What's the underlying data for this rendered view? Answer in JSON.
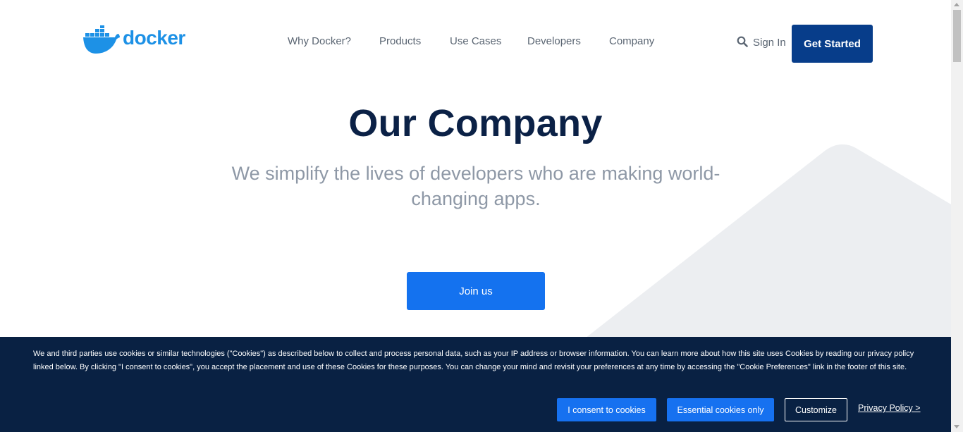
{
  "header": {
    "logo_text": "docker",
    "nav": [
      "Why Docker?",
      "Products",
      "Use Cases",
      "Developers",
      "Company"
    ],
    "sign_in": "Sign In",
    "get_started": "Get Started"
  },
  "hero": {
    "title": "Our Company",
    "subtitle": "We simplify the lives of developers who are making world-changing apps.",
    "join_button": "Join us"
  },
  "cookie_banner": {
    "text": "We and third parties use cookies or similar technologies (\"Cookies\") as described below to collect and process personal data, such as your IP address or browser information. You can learn more about how this site uses Cookies by reading our privacy policy linked below. By clicking \"I consent to cookies\", you accept the placement and use of these Cookies for these purposes. You can change your mind and revisit your preferences at any time by accessing the \"Cookie Preferences\" link in the footer of this site.",
    "consent_button": "I consent to cookies",
    "essential_button": "Essential cookies only",
    "customize_button": "Customize",
    "privacy_link": "Privacy Policy >"
  },
  "colors": {
    "brand_blue": "#1d91e6",
    "primary_button": "#073d8a",
    "join_button": "#1472ef",
    "banner_bg": "#092143",
    "title": "#0b2146"
  },
  "icons": [
    "docker-whale-icon",
    "search-icon"
  ]
}
